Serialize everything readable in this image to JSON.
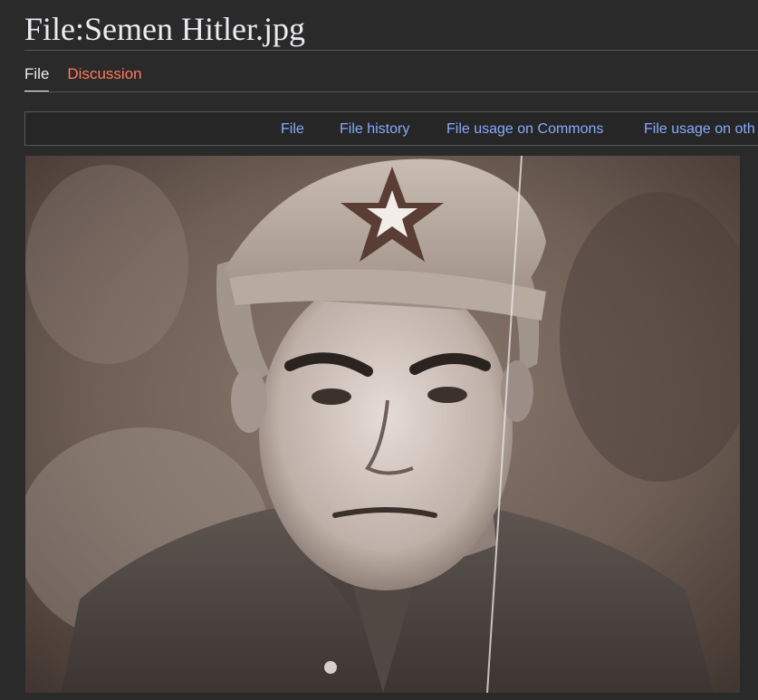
{
  "page": {
    "title": "File:Semen Hitler.jpg"
  },
  "tabs": [
    {
      "label": "File",
      "selected": true
    },
    {
      "label": "Discussion",
      "selected": false
    }
  ],
  "toc": {
    "items": [
      {
        "label": "File"
      },
      {
        "label": "File history"
      },
      {
        "label": "File usage on Commons"
      },
      {
        "label": "File usage on oth"
      }
    ]
  },
  "image": {
    "subject": "sepia portrait of a young soldier in a budenovka cap with a star emblem"
  },
  "colors": {
    "background": "#2a2a2a",
    "text": "#eaecf0",
    "link_tab": "#ff7a5c",
    "toc_link": "#88a9ff",
    "border": "#54595d"
  }
}
